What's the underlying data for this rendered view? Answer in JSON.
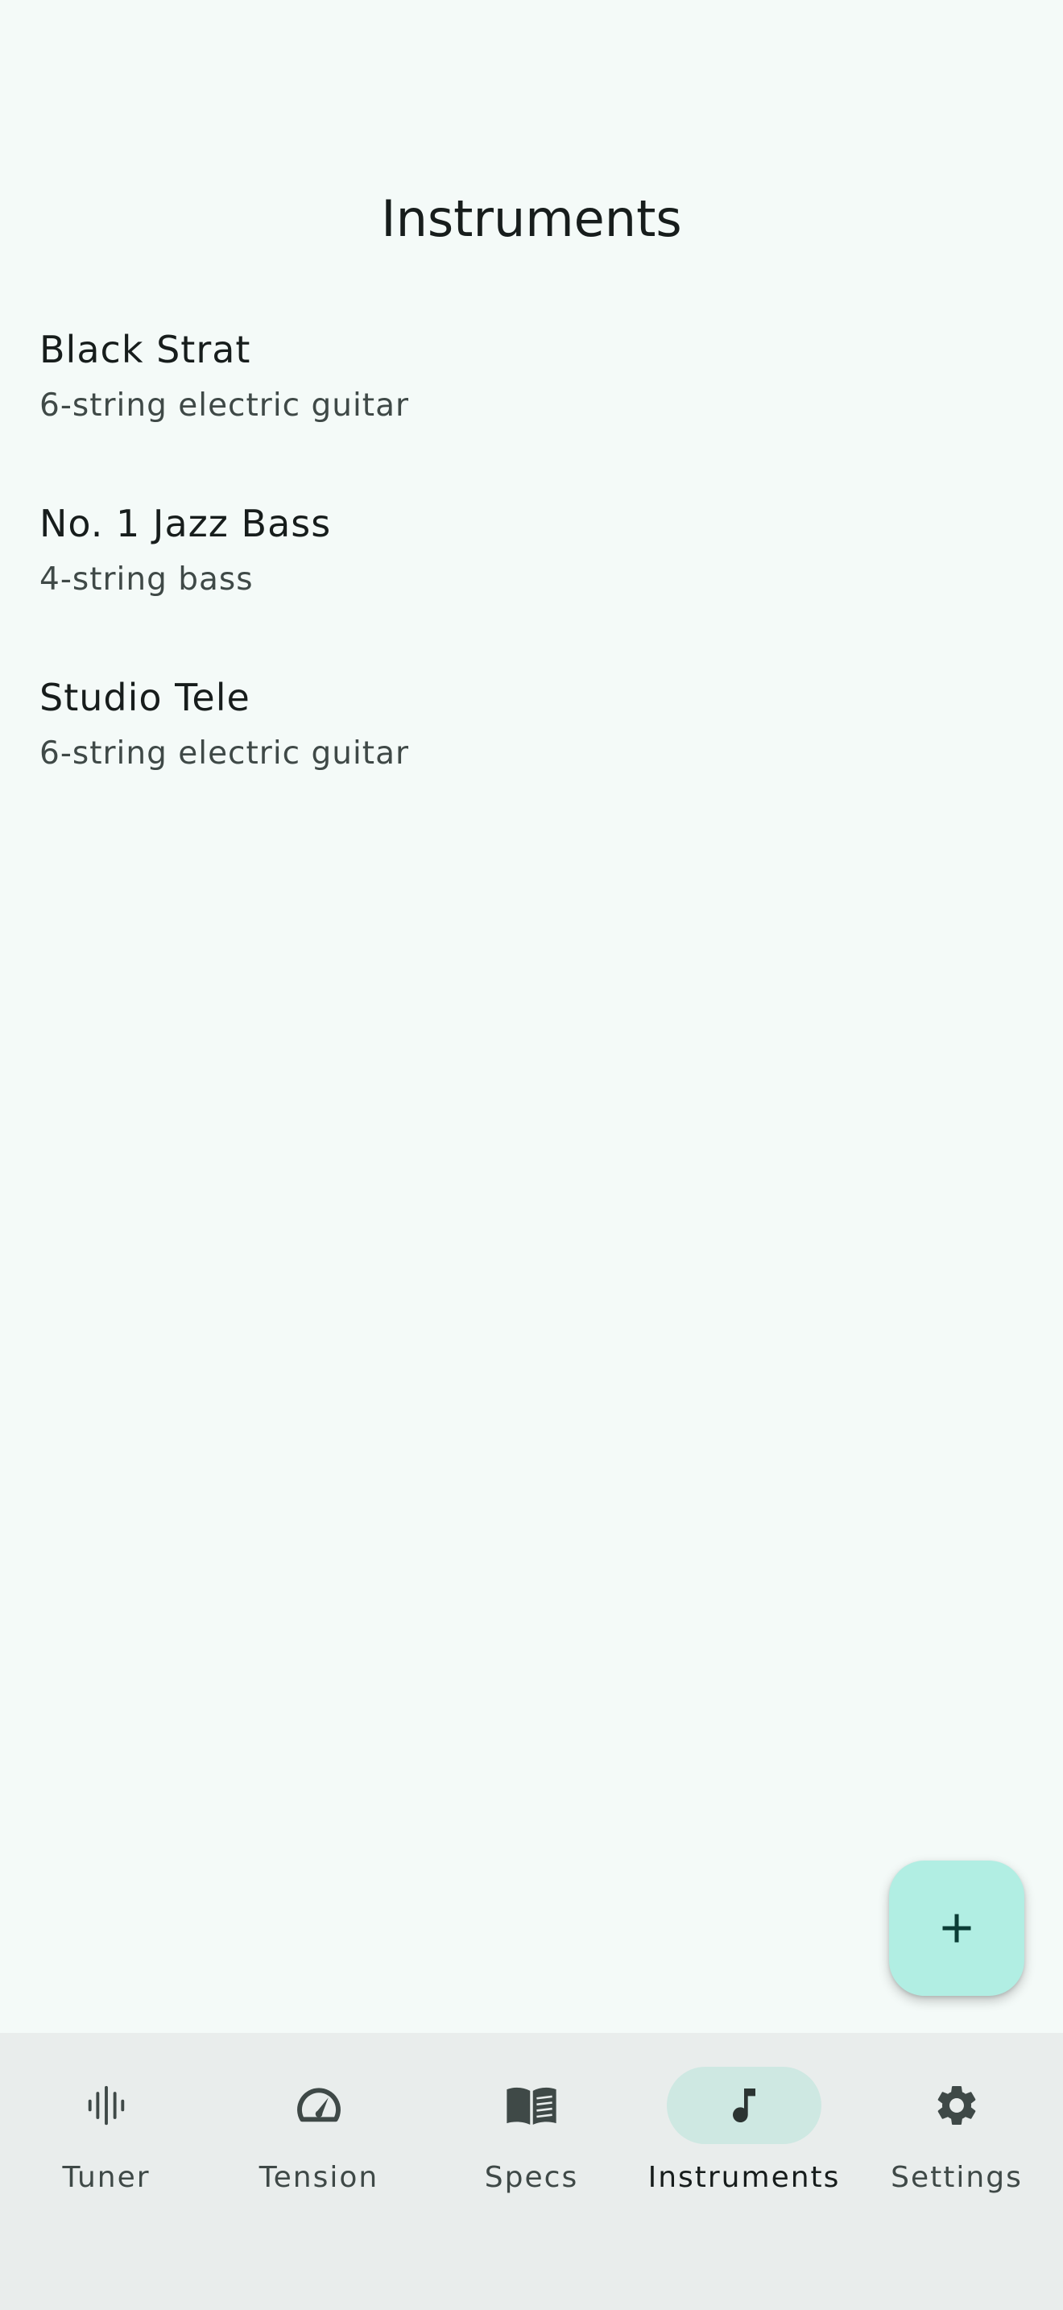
{
  "header": {
    "title": "Instruments"
  },
  "instruments": [
    {
      "name": "Black Strat",
      "type": "6-string electric guitar"
    },
    {
      "name": "No. 1 Jazz Bass",
      "type": "4-string bass"
    },
    {
      "name": "Studio Tele",
      "type": "6-string electric guitar"
    }
  ],
  "fab": {
    "icon": "plus-icon"
  },
  "nav": {
    "active": "Instruments",
    "items": [
      {
        "label": "Tuner",
        "icon": "waveform-icon"
      },
      {
        "label": "Tension",
        "icon": "gauge-icon"
      },
      {
        "label": "Specs",
        "icon": "book-icon"
      },
      {
        "label": "Instruments",
        "icon": "music-note-icon"
      },
      {
        "label": "Settings",
        "icon": "gear-icon"
      }
    ]
  },
  "colors": {
    "background": "#f4faf8",
    "fab": "#b1eee3",
    "nav_background": "#e9edec",
    "nav_active_pill": "#cee8e2",
    "icon": "#3f4947"
  }
}
